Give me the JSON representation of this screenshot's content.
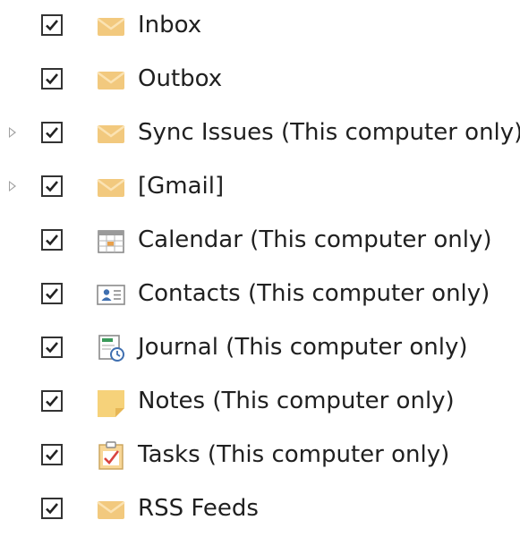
{
  "folder_list": {
    "items": [
      {
        "label": "Inbox",
        "checked": true,
        "icon": "mail-icon",
        "expandable": false
      },
      {
        "label": "Outbox",
        "checked": true,
        "icon": "mail-icon",
        "expandable": false
      },
      {
        "label": "Sync Issues (This computer only)",
        "checked": true,
        "icon": "mail-icon",
        "expandable": true
      },
      {
        "label": "[Gmail]",
        "checked": true,
        "icon": "mail-icon",
        "expandable": true
      },
      {
        "label": "Calendar (This computer only)",
        "checked": true,
        "icon": "calendar-icon",
        "expandable": false
      },
      {
        "label": "Contacts (This computer only)",
        "checked": true,
        "icon": "contacts-icon",
        "expandable": false
      },
      {
        "label": "Journal (This computer only)",
        "checked": true,
        "icon": "journal-icon",
        "expandable": false
      },
      {
        "label": "Notes (This computer only)",
        "checked": true,
        "icon": "notes-icon",
        "expandable": false
      },
      {
        "label": "Tasks (This computer only)",
        "checked": true,
        "icon": "tasks-icon",
        "expandable": false
      },
      {
        "label": "RSS Feeds",
        "checked": true,
        "icon": "mail-icon",
        "expandable": false
      }
    ]
  },
  "colors": {
    "envelope": "#f2c97e",
    "envelope_flap": "#fbe3b3",
    "checkmark": "#222222",
    "expander": "#a0a0a0",
    "calendar_accent": "#e8a04a",
    "contacts_accent": "#3f6fb0",
    "notes": "#f6d27a",
    "tasks_check": "#d9443f"
  }
}
